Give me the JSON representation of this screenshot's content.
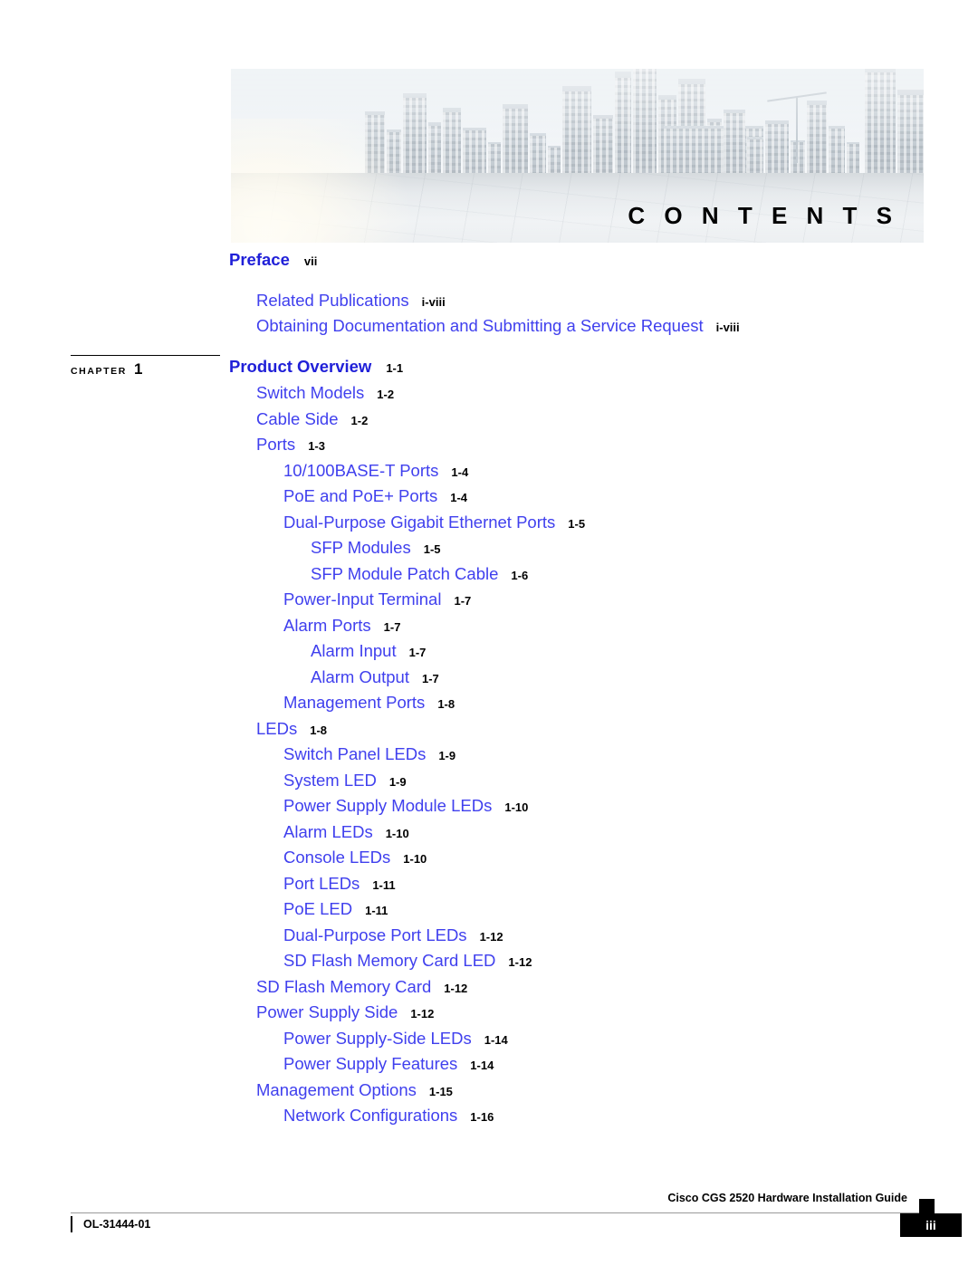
{
  "banner": {
    "title": "C O N T E N T S",
    "image_alt": "city-skyline-photo"
  },
  "chapter_marker": {
    "word": "CHAPTER",
    "number": "1"
  },
  "colors": {
    "heading_blue": "#2020d8",
    "link_blue": "#4040ee",
    "page_number": "#000000"
  },
  "toc": [
    {
      "label": "Preface",
      "page": "vii",
      "level": "h"
    },
    {
      "label": "Related Publications",
      "page": "i-viii",
      "level": "1"
    },
    {
      "label": "Obtaining Documentation and Submitting a Service Request",
      "page": "i-viii",
      "level": "1"
    },
    {
      "label": "Product Overview",
      "page": "1-1",
      "level": "h"
    },
    {
      "label": "Switch Models",
      "page": "1-2",
      "level": "1"
    },
    {
      "label": "Cable Side",
      "page": "1-2",
      "level": "1"
    },
    {
      "label": "Ports",
      "page": "1-3",
      "level": "1"
    },
    {
      "label": "10/100BASE-T Ports",
      "page": "1-4",
      "level": "2"
    },
    {
      "label": "PoE and PoE+ Ports",
      "page": "1-4",
      "level": "2"
    },
    {
      "label": "Dual-Purpose Gigabit Ethernet Ports",
      "page": "1-5",
      "level": "2"
    },
    {
      "label": "SFP Modules",
      "page": "1-5",
      "level": "3"
    },
    {
      "label": "SFP Module Patch Cable",
      "page": "1-6",
      "level": "3"
    },
    {
      "label": "Power-Input Terminal",
      "page": "1-7",
      "level": "2"
    },
    {
      "label": "Alarm Ports",
      "page": "1-7",
      "level": "2"
    },
    {
      "label": "Alarm Input",
      "page": "1-7",
      "level": "3"
    },
    {
      "label": "Alarm Output",
      "page": "1-7",
      "level": "3"
    },
    {
      "label": "Management Ports",
      "page": "1-8",
      "level": "2"
    },
    {
      "label": "LEDs",
      "page": "1-8",
      "level": "1"
    },
    {
      "label": "Switch Panel LEDs",
      "page": "1-9",
      "level": "2"
    },
    {
      "label": "System LED",
      "page": "1-9",
      "level": "2"
    },
    {
      "label": "Power Supply Module LEDs",
      "page": "1-10",
      "level": "2"
    },
    {
      "label": "Alarm LEDs",
      "page": "1-10",
      "level": "2"
    },
    {
      "label": "Console LEDs",
      "page": "1-10",
      "level": "2"
    },
    {
      "label": "Port LEDs",
      "page": "1-11",
      "level": "2"
    },
    {
      "label": "PoE LED",
      "page": "1-11",
      "level": "2"
    },
    {
      "label": "Dual-Purpose Port LEDs",
      "page": "1-12",
      "level": "2"
    },
    {
      "label": "SD Flash Memory Card LED",
      "page": "1-12",
      "level": "2"
    },
    {
      "label": "SD Flash Memory Card",
      "page": "1-12",
      "level": "1"
    },
    {
      "label": "Power Supply Side",
      "page": "1-12",
      "level": "1"
    },
    {
      "label": "Power Supply-Side LEDs",
      "page": "1-14",
      "level": "2"
    },
    {
      "label": "Power Supply Features",
      "page": "1-14",
      "level": "2"
    },
    {
      "label": "Management Options",
      "page": "1-15",
      "level": "1"
    },
    {
      "label": "Network Configurations",
      "page": "1-16",
      "level": "2"
    }
  ],
  "footer": {
    "guide_title": "Cisco CGS 2520 Hardware Installation Guide",
    "doc_id": "OL-31444-01",
    "page_number": "iii"
  }
}
